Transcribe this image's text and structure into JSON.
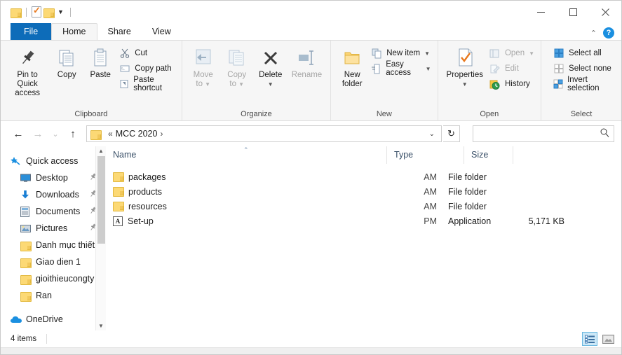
{
  "window": {
    "title": "",
    "controls": {
      "minimize": "—",
      "maximize": "☐",
      "close": "✕"
    }
  },
  "quick_access_toolbar": {
    "items": [
      {
        "name": "properties-folder",
        "icon": "folder-icon"
      },
      {
        "name": "properties",
        "icon": "properties-checkmark-icon"
      },
      {
        "name": "new-folder",
        "icon": "folder-icon"
      },
      {
        "name": "customize-dropdown",
        "icon": "chevron-down-icon",
        "glyph": "▾"
      }
    ]
  },
  "tabs": [
    {
      "label": "File",
      "active": false,
      "style": "file"
    },
    {
      "label": "Home",
      "active": true
    },
    {
      "label": "Share",
      "active": false
    },
    {
      "label": "View",
      "active": false
    }
  ],
  "ribbon_right": {
    "collapse": "⌃",
    "help": "?"
  },
  "ribbon": {
    "groups": [
      {
        "label": "Clipboard",
        "big_buttons": [
          {
            "label": "Pin to Quick\naccess",
            "line1": "Pin to Quick",
            "line2": "access",
            "icon": "pin-icon",
            "disabled": false
          },
          {
            "label": "Copy",
            "line1": "Copy",
            "line2": "",
            "icon": "copy-icon",
            "disabled": false
          },
          {
            "label": "Paste",
            "line1": "Paste",
            "line2": "",
            "icon": "paste-icon",
            "disabled": false
          }
        ],
        "small_buttons": [
          {
            "label": "Cut",
            "icon": "scissors-icon",
            "disabled": false
          },
          {
            "label": "Copy path",
            "icon": "copy-path-icon",
            "disabled": false
          },
          {
            "label": "Paste shortcut",
            "icon": "paste-shortcut-icon",
            "disabled": false
          }
        ]
      },
      {
        "label": "Organize",
        "big_buttons": [
          {
            "line1": "Move",
            "line2": "to",
            "icon": "move-to-icon",
            "disabled": true,
            "caret": true
          },
          {
            "line1": "Copy",
            "line2": "to",
            "icon": "copy-to-icon",
            "disabled": true,
            "caret": true
          },
          {
            "line1": "Delete",
            "line2": "",
            "icon": "delete-x-icon",
            "disabled": false,
            "caret": true
          },
          {
            "line1": "Rename",
            "line2": "",
            "icon": "rename-icon",
            "disabled": true
          }
        ],
        "small_buttons": []
      },
      {
        "label": "New",
        "big_buttons": [
          {
            "line1": "New",
            "line2": "folder",
            "icon": "new-folder-icon",
            "disabled": false
          }
        ],
        "small_buttons": [
          {
            "label": "New item",
            "icon": "new-item-icon",
            "disabled": false,
            "caret": true
          },
          {
            "label": "Easy access",
            "icon": "easy-access-icon",
            "disabled": false,
            "caret": true
          }
        ]
      },
      {
        "label": "Open",
        "big_buttons": [
          {
            "line1": "Properties",
            "line2": "",
            "icon": "properties-checkmark-icon",
            "disabled": false,
            "caret": true
          }
        ],
        "small_buttons": [
          {
            "label": "Open",
            "icon": "open-icon",
            "disabled": true,
            "caret": true
          },
          {
            "label": "Edit",
            "icon": "edit-icon",
            "disabled": true
          },
          {
            "label": "History",
            "icon": "history-icon",
            "disabled": false
          }
        ]
      },
      {
        "label": "Select",
        "big_buttons": [],
        "small_buttons": [
          {
            "label": "Select all",
            "icon": "select-all-icon",
            "disabled": false
          },
          {
            "label": "Select none",
            "icon": "select-none-icon",
            "disabled": false
          },
          {
            "label": "Invert selection",
            "icon": "invert-selection-icon",
            "disabled": false
          }
        ]
      }
    ]
  },
  "address_bar": {
    "back": "←",
    "forward": "→",
    "recent": "⌄",
    "up": "↑",
    "breadcrumb": {
      "prefix": "«",
      "path": "MCC 2020",
      "suffix": "›"
    },
    "dropdown": "⌄",
    "refresh": "↻",
    "search_placeholder": "",
    "search_value": "",
    "search_icon": "search-icon"
  },
  "navigation_pane": {
    "items": [
      {
        "label": "Quick access",
        "icon": "star-pin-icon",
        "indent": false,
        "pinned": false
      },
      {
        "label": "Desktop",
        "icon": "desktop-icon",
        "indent": true,
        "pinned": true
      },
      {
        "label": "Downloads",
        "icon": "download-arrow-icon",
        "indent": true,
        "pinned": true
      },
      {
        "label": "Documents",
        "icon": "documents-icon",
        "indent": true,
        "pinned": true
      },
      {
        "label": "Pictures",
        "icon": "pictures-icon",
        "indent": true,
        "pinned": true
      },
      {
        "label": "Danh mục thiết",
        "icon": "folder-icon",
        "indent": true,
        "pinned": false
      },
      {
        "label": "Giao dien 1",
        "icon": "folder-icon",
        "indent": true,
        "pinned": false
      },
      {
        "label": "gioithieucongty",
        "icon": "folder-icon",
        "indent": true,
        "pinned": false
      },
      {
        "label": "Ran",
        "icon": "folder-icon",
        "indent": true,
        "pinned": false
      },
      {
        "label": "OneDrive",
        "icon": "onedrive-cloud-icon",
        "indent": false,
        "pinned": false
      }
    ],
    "pin_glyph": "📌"
  },
  "file_list": {
    "columns": [
      {
        "key": "name",
        "label": "Name",
        "sorted": true,
        "sort_glyph": "⌃"
      },
      {
        "key": "date",
        "label": ""
      },
      {
        "key": "type",
        "label": "Type"
      },
      {
        "key": "size",
        "label": "Size"
      }
    ],
    "rows": [
      {
        "name": "packages",
        "date": "AM",
        "type": "File folder",
        "size": "",
        "icon": "folder-icon"
      },
      {
        "name": "products",
        "date": "AM",
        "type": "File folder",
        "size": "",
        "icon": "folder-icon"
      },
      {
        "name": "resources",
        "date": "AM",
        "type": "File folder",
        "size": "",
        "icon": "folder-icon"
      },
      {
        "name": "Set-up",
        "date": "PM",
        "type": "Application",
        "size": "5,171 KB",
        "icon": "adobe-app-icon",
        "icon_text": "A"
      }
    ]
  },
  "status_bar": {
    "item_count": "4 items",
    "views": [
      {
        "name": "details-view",
        "selected": true,
        "icon": "details-view-icon"
      },
      {
        "name": "large-icons-view",
        "selected": false,
        "icon": "large-icons-view-icon"
      }
    ]
  }
}
